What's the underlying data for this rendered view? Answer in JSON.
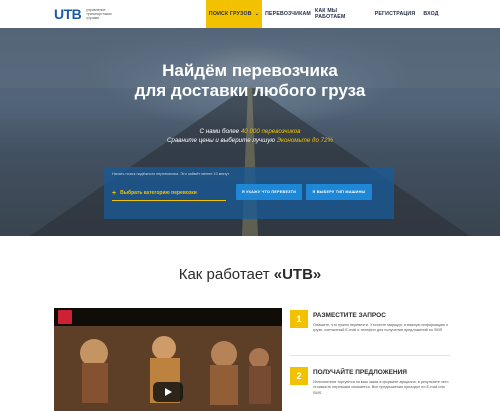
{
  "header": {
    "logo": "UTB",
    "logo_subtitle": "управление транспортными грузами",
    "nav": [
      {
        "label": "ПОИСК ГРУЗОВ",
        "active": true
      },
      {
        "label": "ПЕРЕВОЗЧИКАМ",
        "active": false
      },
      {
        "label": "КАК МЫ РАБОТАЕМ",
        "active": false
      },
      {
        "label": "РЕГИСТРАЦИЯ",
        "active": false
      },
      {
        "label": "ВХОД",
        "active": false
      }
    ]
  },
  "hero": {
    "title_line1": "Найдём перевозчика",
    "title_line2": "для доставки любого груза",
    "sub_line1_pre": "С нами более",
    "sub_line1_highlight": "40 000 перевозчиков",
    "sub_line2_pre": "Сравните цены и выберите лучшую",
    "sub_line2_highlight": "Экономьте до 72%"
  },
  "search": {
    "hint": "Начать поиск надёжного перевозчика. Это займёт менее 10 минут",
    "category_label": "Выбрать категорию перевозки",
    "btn_specify": "Я УКАЖУ ЧТО ПЕРЕВЕЗТИ",
    "btn_choose_type": "Я ВЫБЕРУ ТИП МАШИНЫ"
  },
  "how": {
    "title_pre": "Как работает",
    "title_brand": "«UTB»"
  },
  "video": {
    "caption": ""
  },
  "steps": [
    {
      "num": "1",
      "title": "РАЗМЕСТИТЕ ЗАПРОС",
      "desc": "Опишите, что нужно перевезти. Уточните маршрут и важную информацию о грузе, контактный E-mail и телефон для получения предложений по SMS"
    },
    {
      "num": "2",
      "title": "ПОЛУЧАЙТЕ ПРЕДЛОЖЕНИЯ",
      "desc": "Исполнители торгуются за ваш заказ в формате аукциона, в результате чего стоимость перевозки снижается. Все предложения приходят по E-mail или SMS"
    }
  ],
  "colors": {
    "accent": "#f2c200",
    "brand_blue": "#1b5aa8",
    "button_blue": "#1e88d6"
  }
}
